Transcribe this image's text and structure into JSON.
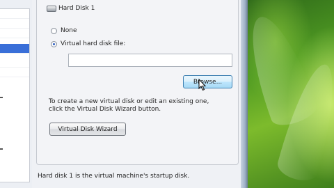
{
  "group": {
    "title": "Hard Disk 1",
    "icon": "hard-disk-icon"
  },
  "options": {
    "none_label": "None",
    "file_label": "Virtual hard disk file:",
    "selected": "Virtual hard disk file:"
  },
  "file_input": {
    "value": ""
  },
  "buttons": {
    "browse_label": "Browse...",
    "wizard_label": "Virtual Disk Wizard"
  },
  "description": {
    "line1": "To create a new virtual disk or edit an existing one,",
    "line2": "click the Virtual Disk Wizard button."
  },
  "footer": {
    "text": "Hard disk 1 is the virtual machine's startup disk."
  },
  "colors": {
    "selection_blue": "#3a6fd8",
    "desktop_green": "#4f9a22",
    "browse_hover": "#bee6fd"
  }
}
